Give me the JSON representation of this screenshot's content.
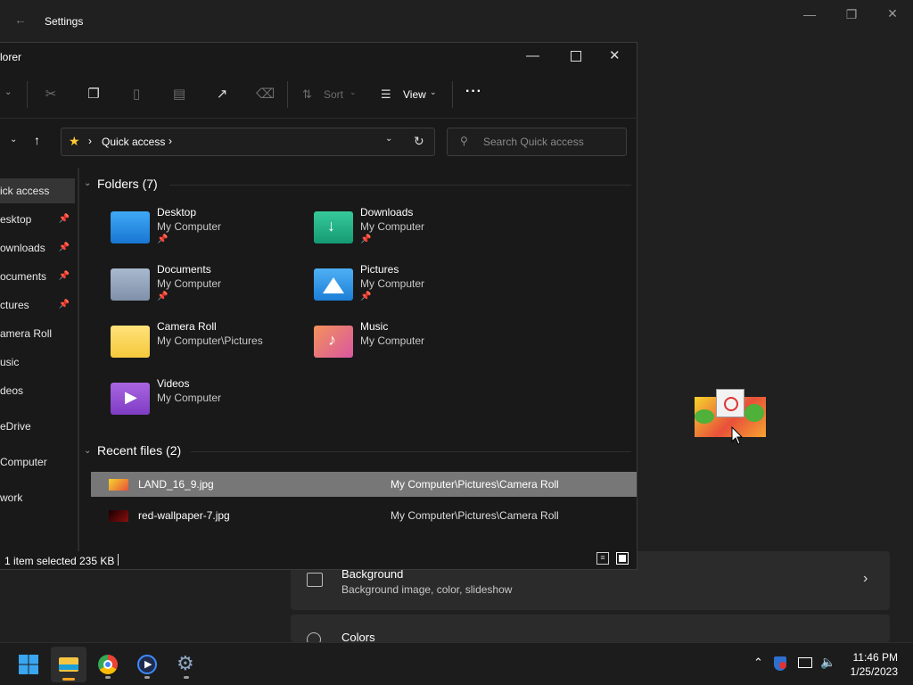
{
  "settings": {
    "title": "Settings",
    "cards": [
      {
        "title": "Background",
        "subtitle": "Background image, color, slideshow"
      },
      {
        "title": "Colors",
        "subtitle": ""
      }
    ]
  },
  "explorer": {
    "title": "lorer",
    "toolbar": {
      "sort_label": "Sort",
      "view_label": "View"
    },
    "address": {
      "location": "Quick access"
    },
    "search": {
      "placeholder": "Search Quick access"
    },
    "sidebar": [
      {
        "label": "ick access",
        "pinned": false,
        "selected": true
      },
      {
        "label": "esktop",
        "pinned": true
      },
      {
        "label": "ownloads",
        "pinned": true
      },
      {
        "label": "ocuments",
        "pinned": true
      },
      {
        "label": "ctures",
        "pinned": true
      },
      {
        "label": "amera Roll",
        "pinned": false
      },
      {
        "label": "usic",
        "pinned": false
      },
      {
        "label": "deos",
        "pinned": false
      },
      {
        "label": "eDrive",
        "pinned": false
      },
      {
        "label": "Computer",
        "pinned": false
      },
      {
        "label": "work",
        "pinned": false
      }
    ],
    "folders_header": "Folders (7)",
    "folders": [
      {
        "name": "Desktop",
        "location": "My Computer",
        "pinned": true
      },
      {
        "name": "Downloads",
        "location": "My Computer",
        "pinned": true
      },
      {
        "name": "Documents",
        "location": "My Computer",
        "pinned": true
      },
      {
        "name": "Pictures",
        "location": "My Computer",
        "pinned": true
      },
      {
        "name": "Camera Roll",
        "location": "My Computer\\Pictures",
        "pinned": false
      },
      {
        "name": "Music",
        "location": "My Computer",
        "pinned": false
      },
      {
        "name": "Videos",
        "location": "My Computer",
        "pinned": false
      }
    ],
    "recent_header": "Recent files (2)",
    "recent": [
      {
        "name": "LAND_16_9.jpg",
        "path": "My Computer\\Pictures\\Camera Roll",
        "selected": true
      },
      {
        "name": "red-wallpaper-7.jpg",
        "path": "My Computer\\Pictures\\Camera Roll",
        "selected": false
      }
    ],
    "status": {
      "selection": "1 item selected",
      "size": "235 KB"
    }
  },
  "taskbar": {
    "time": "11:46 PM",
    "date": "1/25/2023"
  },
  "colors": {
    "accent": "#ffd04a",
    "selected_row": "#777777"
  },
  "icons": {
    "start": "windows-logo-icon",
    "explorer": "folder-icon",
    "browser": "chrome-icon",
    "media": "media-player-icon",
    "settings": "gear-icon",
    "drag": "no-entry-icon"
  }
}
